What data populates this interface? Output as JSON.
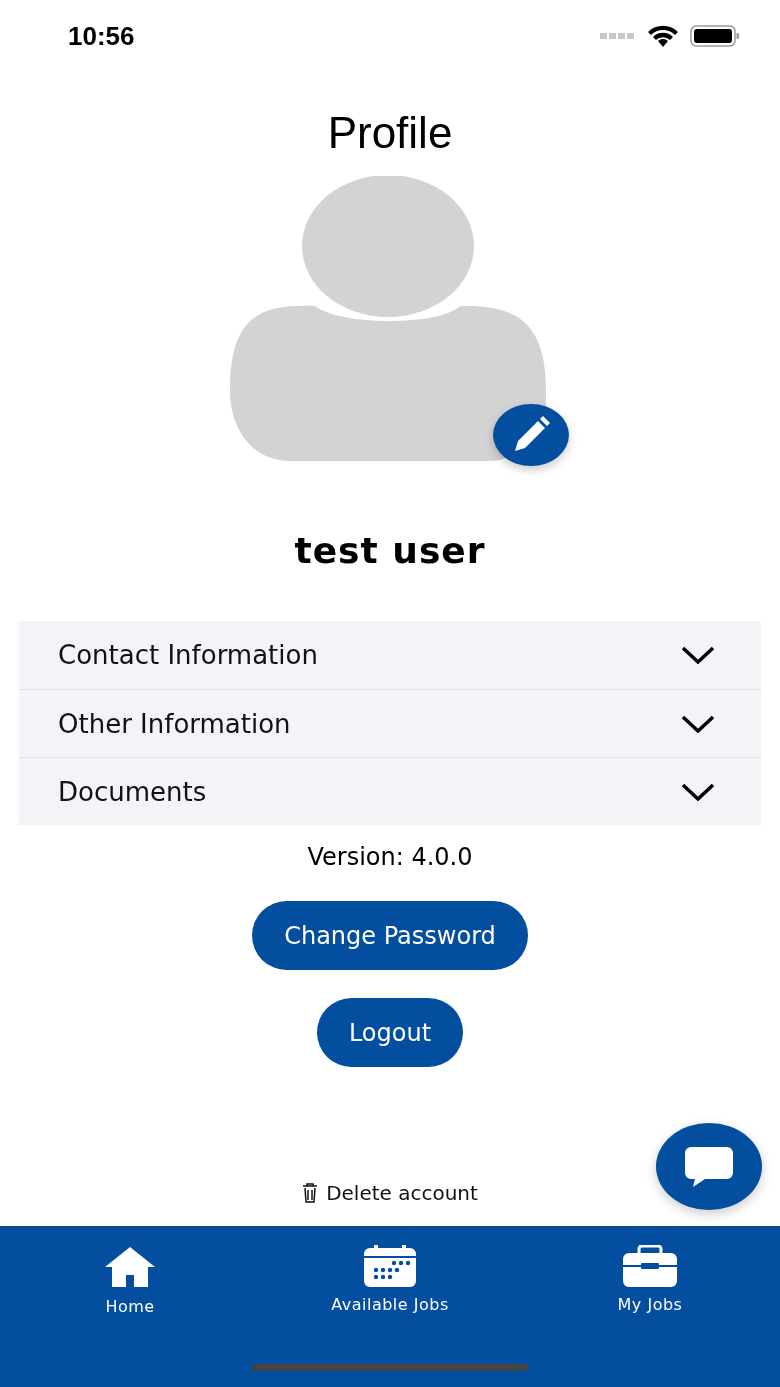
{
  "status_bar": {
    "time": "10:56"
  },
  "title": "Profile",
  "user_name": "test user",
  "sections": [
    {
      "label": "Contact Information",
      "expanded": false
    },
    {
      "label": "Other Information",
      "expanded": false
    },
    {
      "label": "Documents",
      "expanded": false
    }
  ],
  "version": "Version: 4.0.0",
  "buttons": [
    "Change Password",
    "Logout"
  ],
  "delete_link": "Delete account",
  "nav": [
    {
      "label": "Home",
      "kind": "home"
    },
    {
      "label": "Available Jobs",
      "kind": "calendar"
    },
    {
      "label": "My Jobs",
      "kind": "briefcase"
    }
  ]
}
